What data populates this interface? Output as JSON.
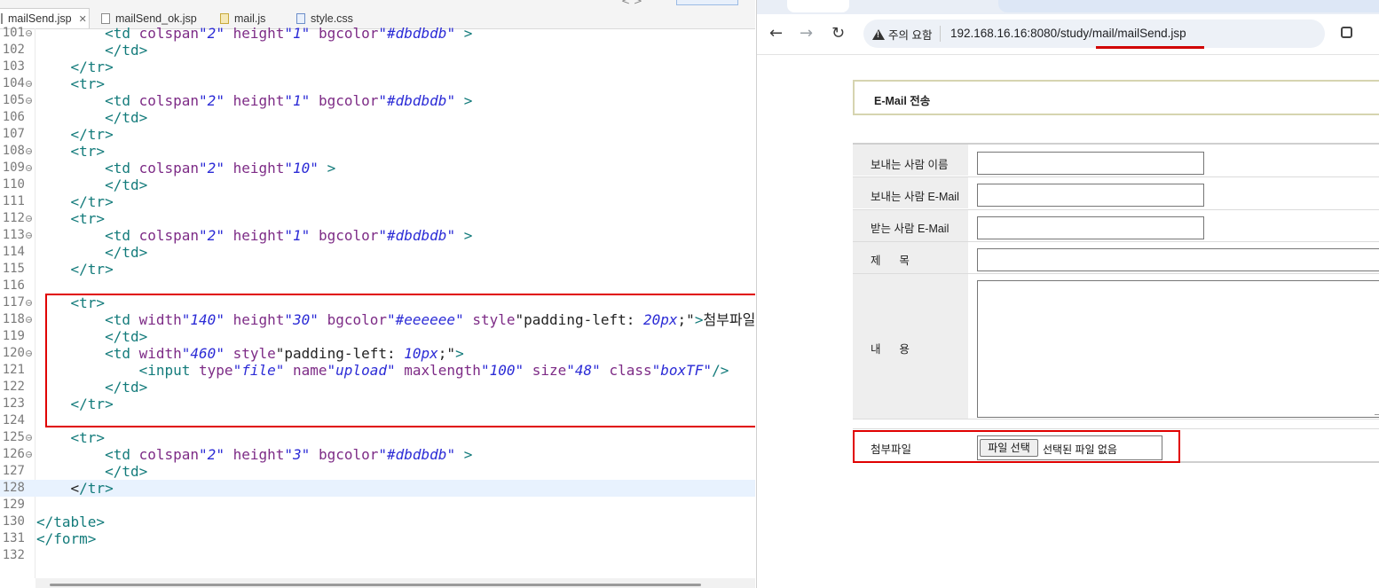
{
  "editor": {
    "tabs": [
      {
        "label": "mailSend.jsp",
        "icon": "jsp-file-icon",
        "active": true,
        "close": "✕"
      },
      {
        "label": "mailSend_ok.jsp",
        "icon": "jsp-file-icon"
      },
      {
        "label": "mail.js",
        "icon": "js-file-icon"
      },
      {
        "label": "style.css",
        "icon": "css-file-icon"
      }
    ],
    "lines": [
      {
        "n": "101",
        "fold": true
      },
      {
        "n": "102"
      },
      {
        "n": "103"
      },
      {
        "n": "104",
        "fold": true
      },
      {
        "n": "105",
        "fold": true
      },
      {
        "n": "106"
      },
      {
        "n": "107"
      },
      {
        "n": "108",
        "fold": true
      },
      {
        "n": "109",
        "fold": true
      },
      {
        "n": "110"
      },
      {
        "n": "111"
      },
      {
        "n": "112",
        "fold": true
      },
      {
        "n": "113",
        "fold": true
      },
      {
        "n": "114"
      },
      {
        "n": "115"
      },
      {
        "n": "116"
      },
      {
        "n": "117",
        "fold": true
      },
      {
        "n": "118",
        "fold": true
      },
      {
        "n": "119"
      },
      {
        "n": "120",
        "fold": true
      },
      {
        "n": "121"
      },
      {
        "n": "122"
      },
      {
        "n": "123"
      },
      {
        "n": "124"
      },
      {
        "n": "125",
        "fold": true
      },
      {
        "n": "126",
        "fold": true
      },
      {
        "n": "127"
      },
      {
        "n": "128",
        "current": true
      },
      {
        "n": "129"
      },
      {
        "n": "130"
      },
      {
        "n": "131"
      },
      {
        "n": "132"
      }
    ],
    "code": {
      "l101_tag": "<td",
      "l101_a1": "colspan",
      "l101_v1": "\"2\"",
      "l101_a2": "height",
      "l101_v2": "\"1\"",
      "l101_a3": "bgcolor",
      "l101_v3": "\"#dbdbdb\"",
      "close_angle": ">",
      "close_td": "</td>",
      "close_tr": "</tr>",
      "open_tr": "<tr>",
      "l109_v2": "\"10\"",
      "l126_v2": "\"3\"",
      "l118_a1": "width",
      "l118_v1": "\"140\"",
      "l118_a2": "height",
      "l118_v2": "\"30\"",
      "l118_a3": "bgcolor",
      "l118_v3": "\"#eeeeee\"",
      "l118_a4": "style",
      "l118_v4a": "\"padding-left: ",
      "l118_v4b": "20px",
      "l118_v4c": ";\"",
      "l118_text": "첨부파일",
      "l120_a1": "width",
      "l120_v1": "\"460\"",
      "l120_a2": "style",
      "l120_v2a": "\"padding-left: ",
      "l120_v2b": "10px",
      "l120_v2c": ";\"",
      "l121_tag": "<input",
      "l121_a1": "type",
      "l121_v1": "\"file\"",
      "l121_a2": "name",
      "l121_v2": "\"upload\"",
      "l121_a3": "maxlength",
      "l121_v3": "\"100\"",
      "l121_a4": "size",
      "l121_v4": "\"48\"",
      "l121_a5": "class",
      "l121_v5": "\"boxTF\"",
      "l121_end": "/>",
      "l128_a": "<",
      "l128_b": "/tr>",
      "l130": "</table>",
      "l131": "</form>"
    }
  },
  "browser": {
    "warning": "주의 요함",
    "url_host": "192.168.16.16:8080",
    "url_path": "/study/mail/mailSend.jsp",
    "form": {
      "title": "E-Mail 전송",
      "sender_name_label": "보내는 사람 이름",
      "sender_email_label": "보내는 사람 E-Mail",
      "receiver_email_label": "받는 사람 E-Mail",
      "subject_label": "제      목",
      "content_label": "내      용",
      "attach_label": "첨부파일",
      "file_button": "파일 선택",
      "file_status": "선택된 파일 없음"
    }
  },
  "colors": {
    "highlight_box": "#e00000",
    "label_bg": "#eeeeee",
    "divider": "#dbdbdb"
  }
}
